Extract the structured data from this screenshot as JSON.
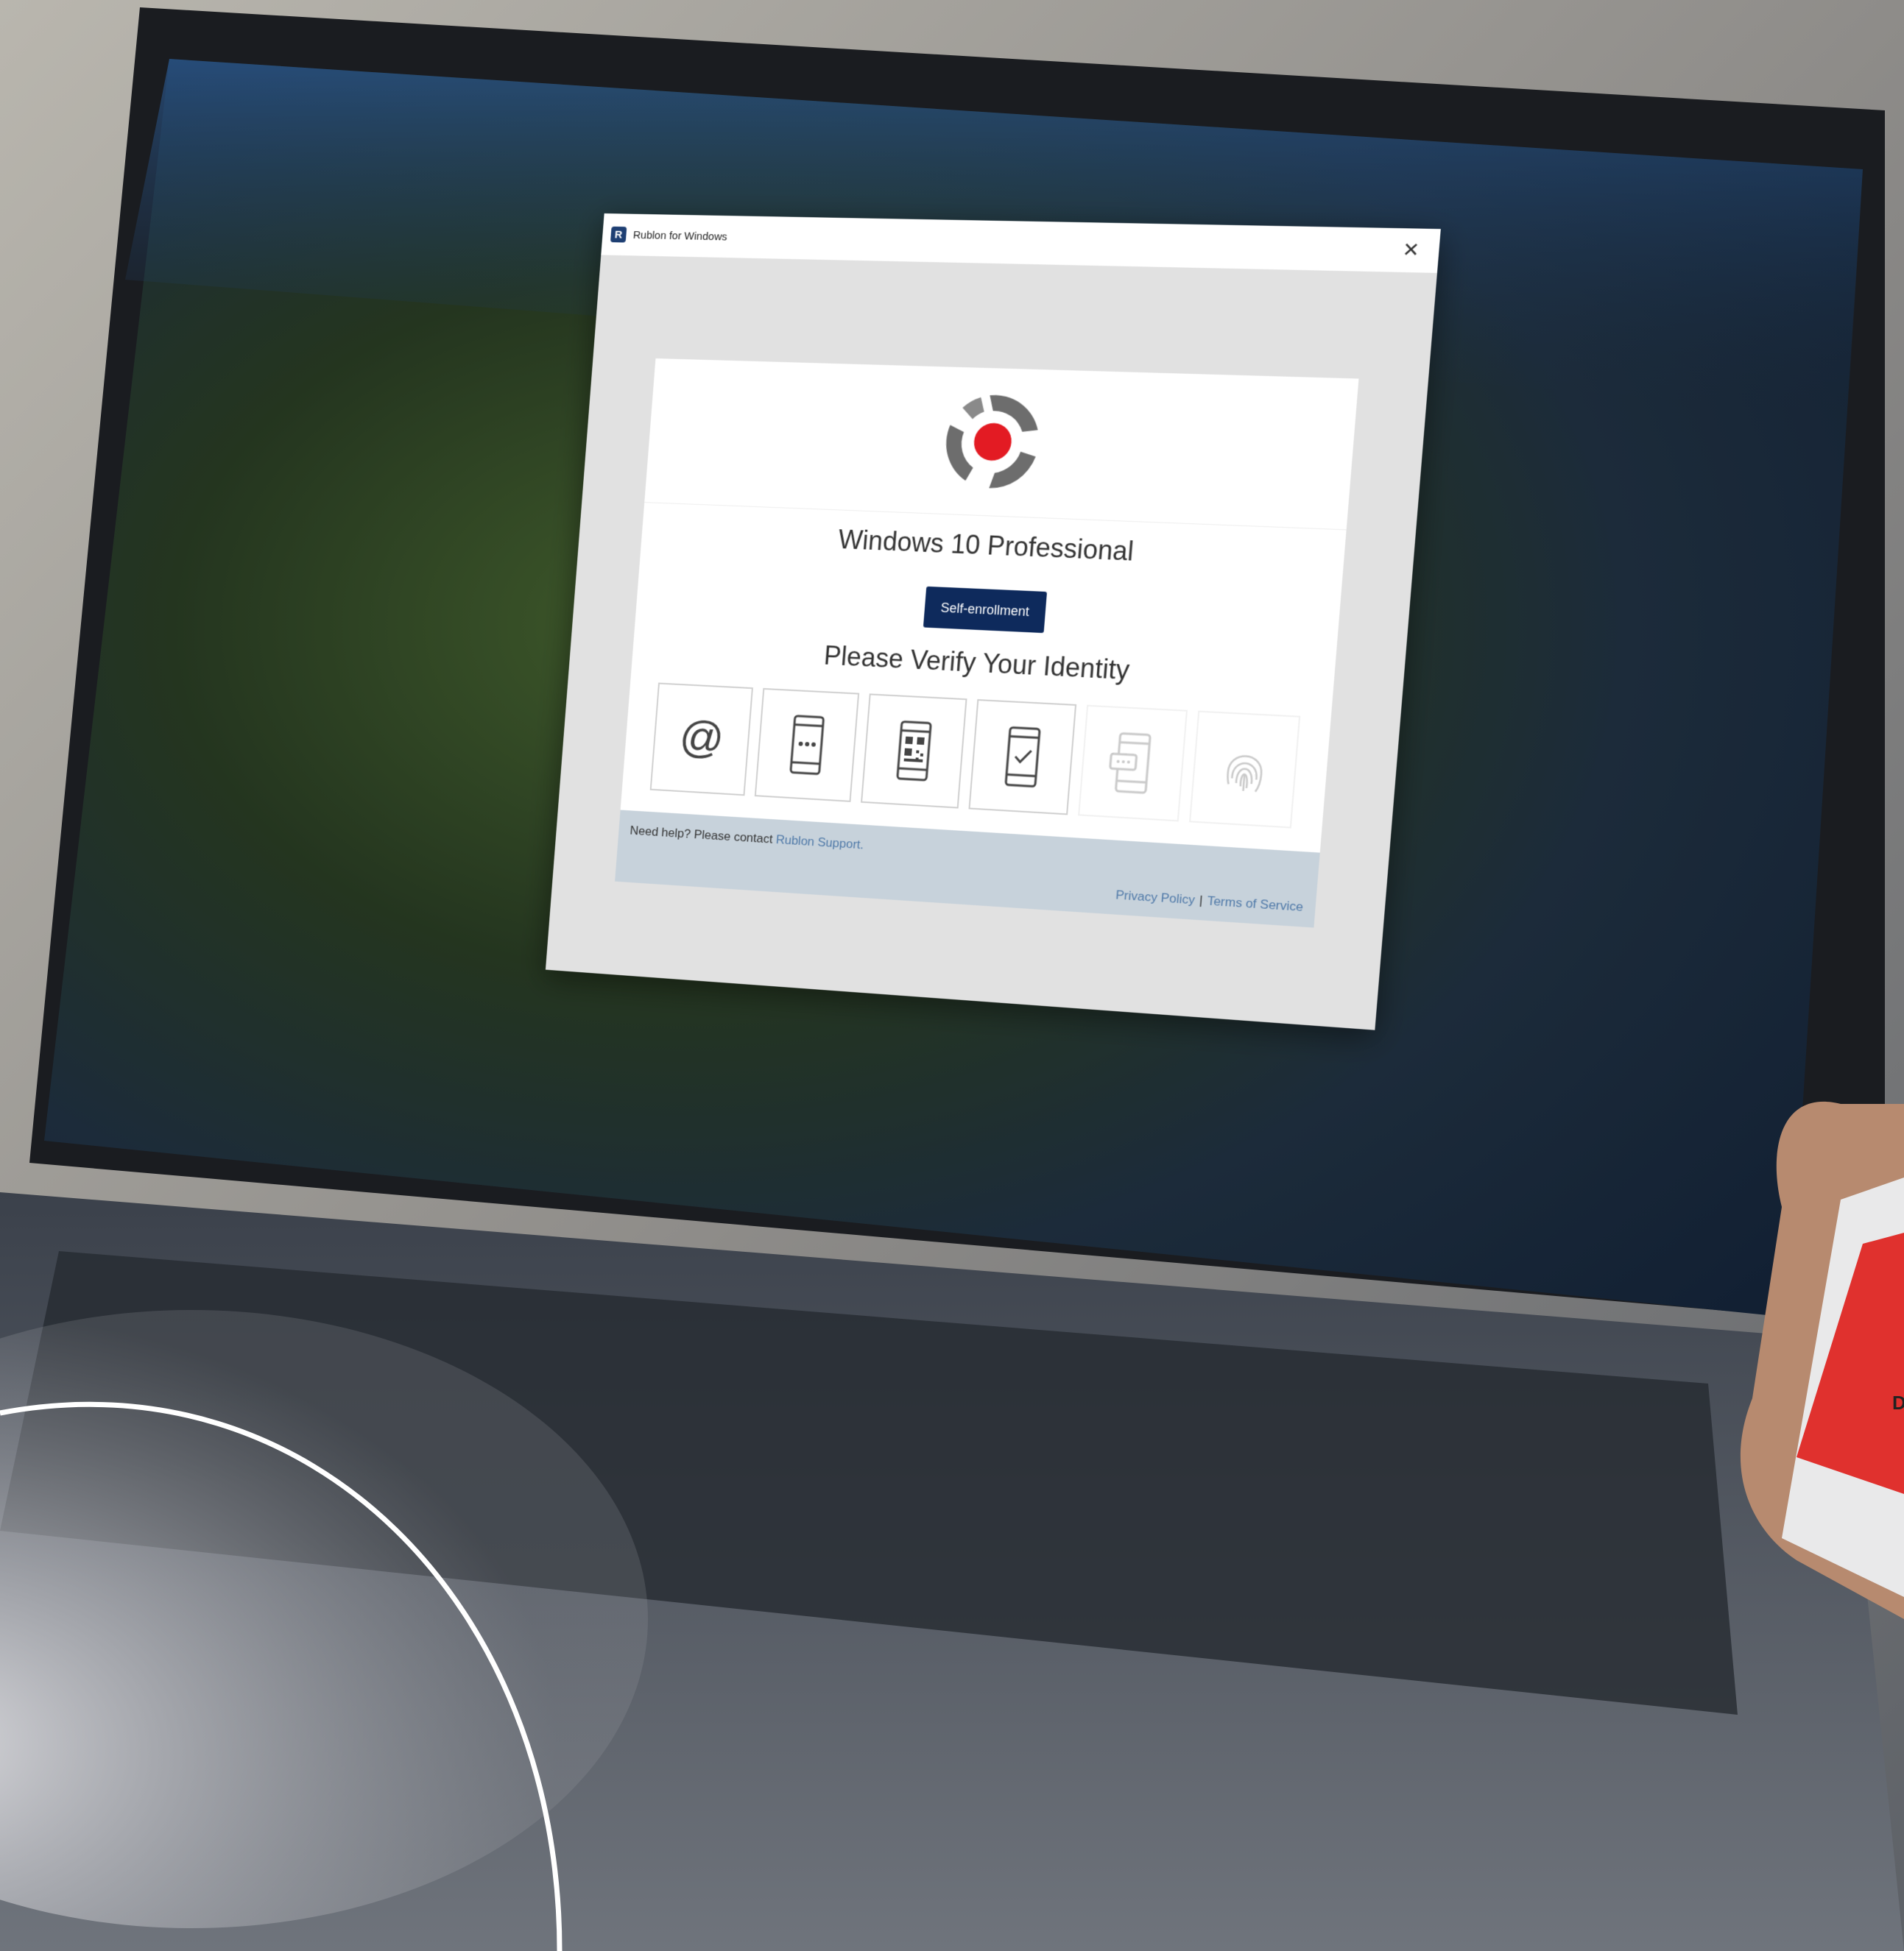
{
  "window": {
    "title": "Rublon for Windows",
    "app_icon_letter": "R",
    "close_symbol": "✕"
  },
  "main": {
    "logo": "rublon-logo",
    "product_name": "Windows 10 Professional",
    "self_enrollment_label": "Self-enrollment",
    "heading": "Please Verify Your Identity",
    "methods": [
      {
        "icon": "email-icon",
        "glyph": "@",
        "enabled": true
      },
      {
        "icon": "sms-code-icon",
        "enabled": true
      },
      {
        "icon": "qr-code-icon",
        "enabled": true
      },
      {
        "icon": "mobile-push-icon",
        "enabled": true
      },
      {
        "icon": "phone-call-icon",
        "enabled": false
      },
      {
        "icon": "fingerprint-icon",
        "enabled": false
      }
    ]
  },
  "footer": {
    "help_text": "Need help? Please contact ",
    "help_link": "Rublon Support.",
    "privacy_link": "Privacy Policy",
    "separator": "|",
    "terms_link": "Terms of Service"
  },
  "colors": {
    "dialog_bg": "#e1e1e1",
    "button_bg": "#0e2a5c",
    "logo_red": "#e31b23",
    "logo_gray": "#6d6d6d",
    "footer_bg": "#c7d2db",
    "link": "#4f79a8",
    "phone_screen_red": "#e0312e"
  },
  "phone": {
    "visible_letter": "D"
  }
}
